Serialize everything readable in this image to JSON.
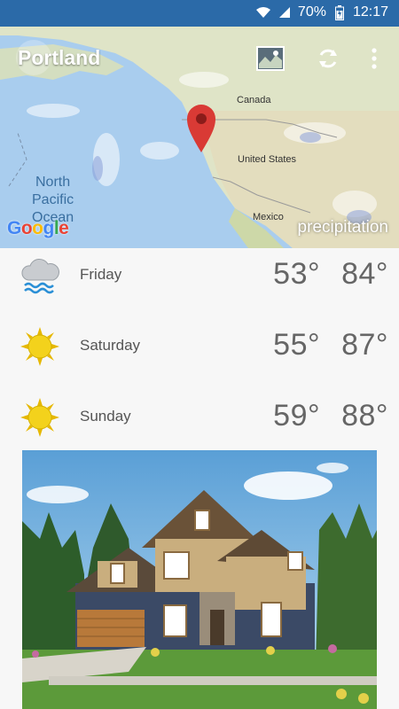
{
  "status": {
    "battery": "70%",
    "time": "12:17"
  },
  "header": {
    "city": "Portland"
  },
  "map": {
    "provider": "Google",
    "layer_label": "precipitation",
    "labels": {
      "canada": "Canada",
      "united_states": "United States",
      "mexico": "Mexico",
      "ocean_line1": "North",
      "ocean_line2": "Pacific",
      "ocean_line3": "Ocean"
    }
  },
  "forecast": [
    {
      "day": "Friday",
      "low": "53°",
      "high": "84°",
      "icon": "rain-cloud-icon"
    },
    {
      "day": "Saturday",
      "low": "55°",
      "high": "87°",
      "icon": "sun-icon"
    },
    {
      "day": "Sunday",
      "low": "59°",
      "high": "88°",
      "icon": "sun-icon"
    }
  ],
  "colors": {
    "statusbar": "#2b6aa8",
    "marker": "#d93a35",
    "sun": "#f3d21c"
  }
}
